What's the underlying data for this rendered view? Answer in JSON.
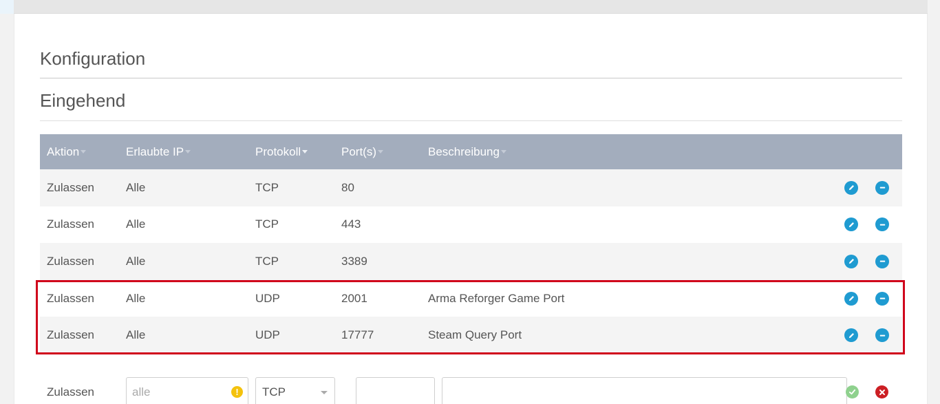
{
  "sections": {
    "configuration_title": "Konfiguration",
    "incoming_title": "Eingehend"
  },
  "table": {
    "headers": {
      "action": "Aktion",
      "allowed_ip": "Erlaubte IP",
      "protocol": "Protokoll",
      "ports": "Port(s)",
      "description": "Beschreibung"
    },
    "rows": [
      {
        "action": "Zulassen",
        "ip": "Alle",
        "protocol": "TCP",
        "port": "80",
        "description": ""
      },
      {
        "action": "Zulassen",
        "ip": "Alle",
        "protocol": "TCP",
        "port": "443",
        "description": ""
      },
      {
        "action": "Zulassen",
        "ip": "Alle",
        "protocol": "TCP",
        "port": "3389",
        "description": ""
      },
      {
        "action": "Zulassen",
        "ip": "Alle",
        "protocol": "UDP",
        "port": "2001",
        "description": "Arma Reforger Game Port"
      },
      {
        "action": "Zulassen",
        "ip": "Alle",
        "protocol": "UDP",
        "port": "17777",
        "description": "Steam Query Port"
      }
    ]
  },
  "new_rule": {
    "action": "Zulassen",
    "ip_placeholder": "alle",
    "ip_value": "",
    "warning_glyph": "!",
    "protocol_selected": "TCP",
    "port_value": "",
    "description_value": ""
  },
  "colors": {
    "header_bg": "#a3adbd",
    "action_blue": "#1f9bd1",
    "highlight_red": "#d0021b",
    "confirm_green": "#8fd18e",
    "cancel_red": "#cc1f24",
    "warning_yellow": "#f4c20d"
  },
  "icons": {
    "edit": "pencil-icon",
    "delete": "minus-circle-icon",
    "confirm": "check-circle-icon",
    "cancel": "close-circle-icon",
    "warning": "warning-icon",
    "sort": "caret-down-icon"
  }
}
